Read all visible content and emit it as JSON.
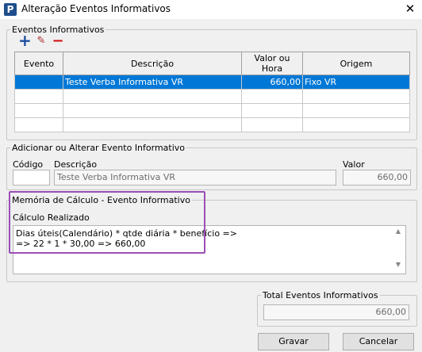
{
  "window": {
    "title": "Alteração Eventos Informativos",
    "icon": "P",
    "close": "✕"
  },
  "eventos": {
    "legend": "Eventos Informativos",
    "columns": [
      "Evento",
      "Descrição",
      "Valor ou Hora",
      "Origem"
    ],
    "rows": [
      {
        "evento": "",
        "descricao": "Teste Verba Informativa VR",
        "valor": "660,00",
        "origem": "Fixo VR"
      }
    ]
  },
  "toolbar": {
    "add": "+",
    "edit": "✎",
    "remove": "−"
  },
  "form": {
    "legend": "Adicionar ou Alterar Evento Informativo",
    "codigo_label": "Código",
    "codigo_value": "",
    "descricao_label": "Descrição",
    "descricao_value": "Teste Verba Informativa VR",
    "valor_label": "Valor",
    "valor_value": "660,00"
  },
  "memoria": {
    "legend": "Memória de Cálculo - Evento Informativo",
    "calculo_label": "Cálculo Realizado",
    "line1": "Dias úteis(Calendário) * qtde diária * benefício =>",
    "line2": "=> 22 * 1 * 30,00 => 660,00"
  },
  "total": {
    "legend": "Total Eventos Informativos",
    "value": "660,00"
  },
  "buttons": {
    "save": "Gravar",
    "cancel": "Cancelar"
  },
  "colors": {
    "selection": "#0078d7",
    "highlight": "#9b4fb5",
    "add": "#1a4fa0",
    "remove": "#d01010"
  }
}
